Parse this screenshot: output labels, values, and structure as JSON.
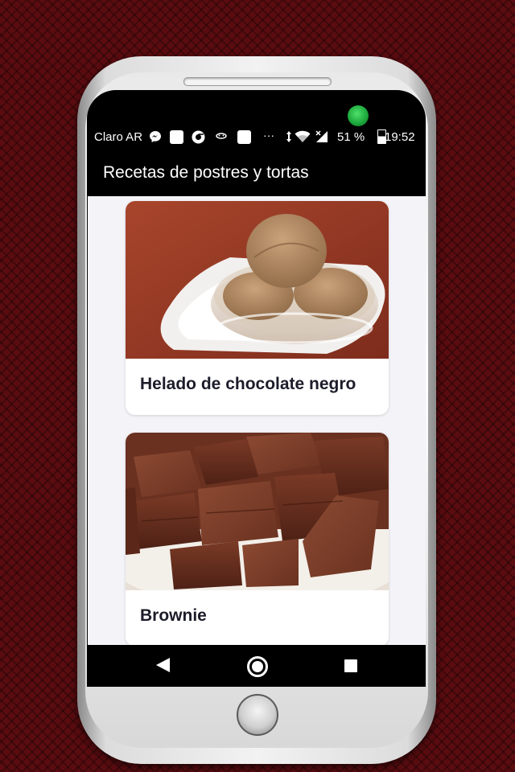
{
  "status_bar": {
    "carrier": "Claro AR",
    "overflow": "···",
    "battery_percent": "51 %",
    "battery_level": 0.51,
    "time": "19:52",
    "icons": [
      "messenger-icon",
      "notification-square-icon",
      "chrome-icon",
      "face-icon",
      "notification-square-icon",
      "data-arrows-icon",
      "wifi-icon",
      "signal-icon",
      "battery-icon"
    ]
  },
  "app_bar": {
    "title": "Recetas de postres y tortas"
  },
  "recipes": [
    {
      "title": "Helado de chocolate negro",
      "image": "chocolate-ice-cream-photo"
    },
    {
      "title": "Brownie",
      "image": "brownie-photo"
    }
  ],
  "nav_bar": {
    "icons": [
      "back-icon",
      "home-icon",
      "recents-icon"
    ]
  },
  "colors": {
    "background": "#5a0c10",
    "app_bar": "#000000",
    "content_background": "#f3f3f8",
    "card_title": "#1c1c2a"
  }
}
